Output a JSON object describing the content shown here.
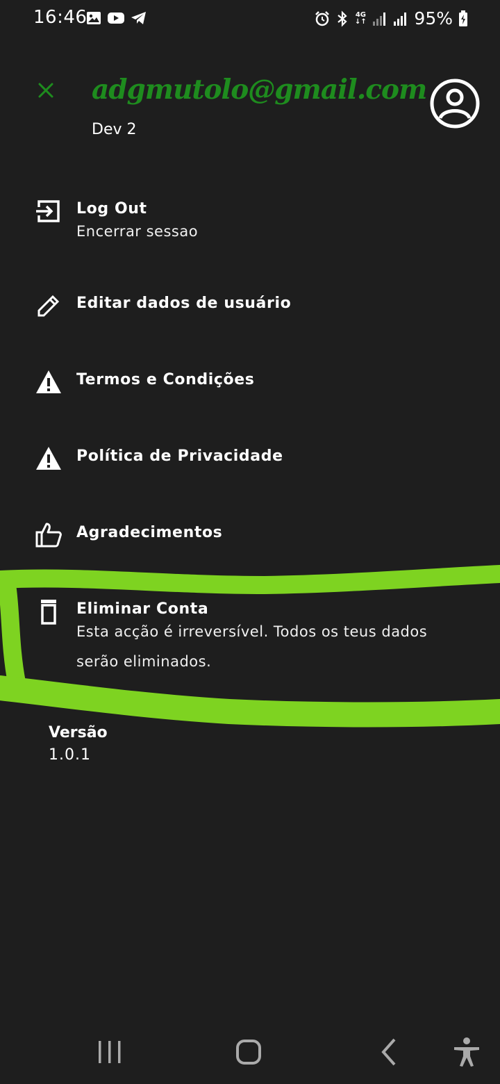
{
  "status_bar": {
    "time": "16:46",
    "network": "4G",
    "battery": "95%",
    "icons": [
      "image-icon",
      "youtube-icon",
      "telegram-icon",
      "alarm-icon",
      "bluetooth-icon",
      "signal-icon",
      "battery-icon"
    ]
  },
  "header": {
    "email": "adgmutolo@gmail.com",
    "name": "Dev 2",
    "close_icon": "close-icon",
    "avatar_icon": "account-circle-icon",
    "email_color": "#1e8c1e"
  },
  "menu": {
    "items": [
      {
        "icon": "logout-icon",
        "title": "Log Out",
        "subtitle": "Encerrar sessao"
      },
      {
        "icon": "pencil-icon",
        "title": "Editar dados de usuário"
      },
      {
        "icon": "warning-icon",
        "title": "Termos e Condições"
      },
      {
        "icon": "warning-icon",
        "title": "Política de Privacidade"
      },
      {
        "icon": "thumbs-up-icon",
        "title": "Agradecimentos"
      },
      {
        "icon": "trash-icon",
        "title": "Eliminar Conta",
        "subtitle": "Esta acção é irreversível. Todos os teus dados serão eliminados."
      }
    ]
  },
  "version": {
    "label": "Versão",
    "value": "1.0.1"
  },
  "annotation": {
    "highlight_color": "#7ed321"
  },
  "nav_bar": {
    "icons": [
      "recent-apps-icon",
      "home-icon",
      "back-icon",
      "accessibility-icon"
    ]
  }
}
